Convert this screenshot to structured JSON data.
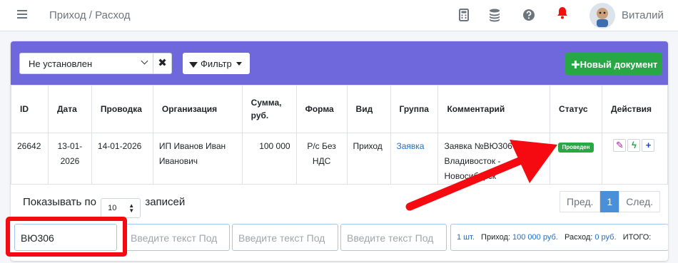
{
  "header": {
    "breadcrumb": "Приход / Расход",
    "icons": [
      "menu-icon",
      "calculator-icon",
      "coins-icon",
      "help-icon",
      "bell-icon"
    ],
    "user_name": "Виталий"
  },
  "toolbar": {
    "status_select": "Не установлен",
    "clear_label": "✖",
    "filter_label": "Фильтр",
    "new_doc_label": "Новый документ"
  },
  "table": {
    "columns": [
      "ID",
      "Дата",
      "Проводка",
      "Организация",
      "Сумма, руб.",
      "Форма",
      "Вид",
      "Группа",
      "Комментарий",
      "Статус",
      "Действия"
    ],
    "rows": [
      {
        "id": "26642",
        "date": "13-01-2026",
        "posting": "14-01-2026",
        "org": "ИП Иванов Иван Иванович",
        "sum": "100 000",
        "form": "Р/с Без НДС",
        "kind": "Приход",
        "group": "Заявка",
        "comment": "Заявка №ВЮ306 Владивосток - Новосибирск",
        "status": "Проведен"
      }
    ]
  },
  "footer": {
    "show_prefix": "Показывать по",
    "per_page": "10",
    "show_suffix": "записей",
    "pager": {
      "prev": "Пред.",
      "page": "1",
      "next": "След."
    }
  },
  "search": {
    "first_value": "ВЮ306",
    "placeholder": "Введите текст Под"
  },
  "totals": {
    "count": "1 шт.",
    "income_label": "Приход:",
    "income_value": "100 000 руб.",
    "expense_label": "Расход:",
    "expense_value": "0 руб.",
    "total_label": "ИТОГО:"
  },
  "colors": {
    "header_purple": "#6f68dd",
    "success_green": "#28a745",
    "annotation_red": "#f50a12",
    "link_blue": "#1f6fd0"
  }
}
